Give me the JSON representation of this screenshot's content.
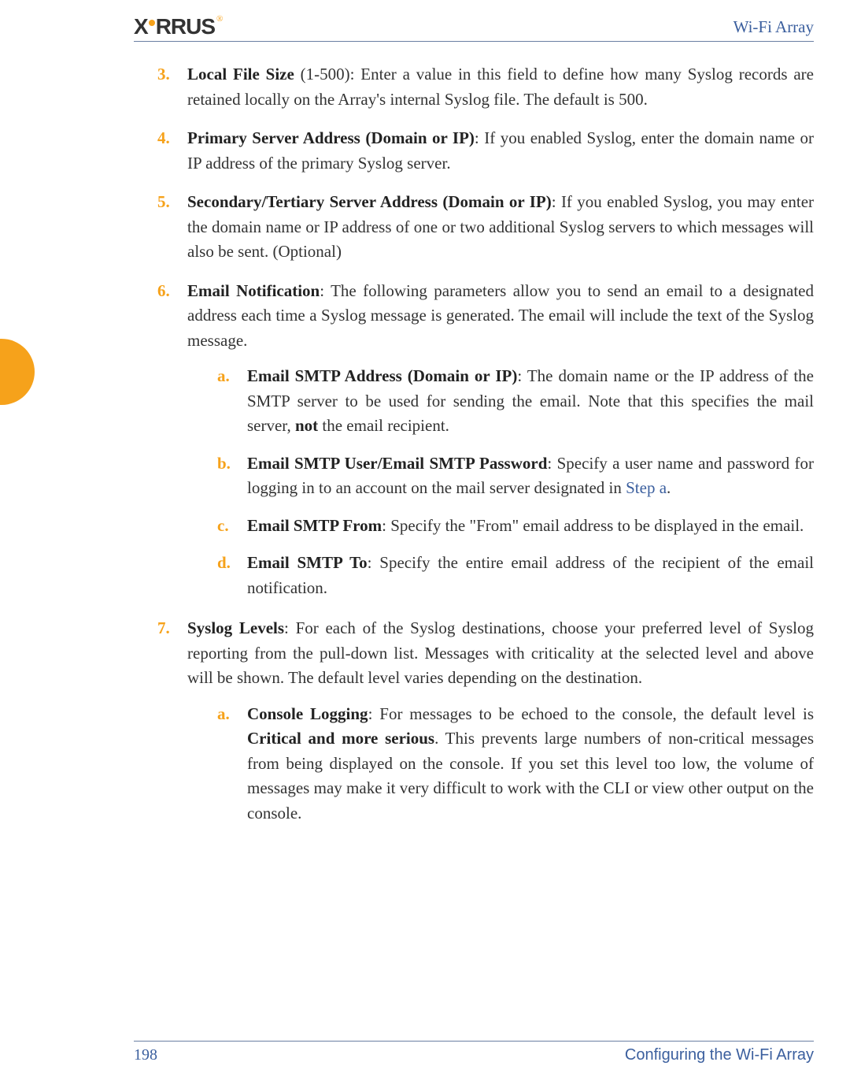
{
  "header": {
    "brand": "XIRRUS",
    "title": "Wi-Fi Array"
  },
  "items": [
    {
      "num": "3.",
      "title": "Local File Size",
      "title_suffix": " (1-500): ",
      "text": "Enter a value in this field to define how many Syslog records are retained locally on the Array's internal Syslog file. The default is 500."
    },
    {
      "num": "4.",
      "title": "Primary Server Address (Domain or IP)",
      "title_suffix": ": ",
      "text": "If you enabled Syslog, enter the domain name or IP address of the primary Syslog server."
    },
    {
      "num": "5.",
      "title": "Secondary/Tertiary Server Address (Domain or IP)",
      "title_suffix": ": ",
      "text": "If you enabled Syslog, you may enter the domain name or IP address of one or two additional Syslog servers to which messages will also be sent. (Optional)"
    },
    {
      "num": "6.",
      "title": "Email Notification",
      "title_suffix": ": ",
      "text": "The following parameters allow you to send an email to a designated address each time a Syslog message is generated. The email will include the text of the Syslog message.",
      "subs": [
        {
          "num": "a.",
          "title": "Email SMTP Address (Domain or IP)",
          "title_suffix": ": ",
          "text_before_bold": "The domain name or the IP address of the SMTP server to be used for sending the email. Note that this specifies the mail server, ",
          "bold_word": "not",
          "text_after_bold": " the email recipient."
        },
        {
          "num": "b.",
          "title": "Email SMTP User/Email SMTP Password",
          "title_suffix": ": ",
          "text_before_link": "Specify a user name and password for logging in to an account on the mail server designated in ",
          "link_text": "Step a",
          "text_after_link": "."
        },
        {
          "num": "c.",
          "title": "Email SMTP From",
          "title_suffix": ": ",
          "text": "Specify the \"From\" email address to be displayed in the email."
        },
        {
          "num": "d.",
          "title": "Email SMTP To",
          "title_suffix": ": ",
          "text": "Specify the entire email address of the recipient of the email notification."
        }
      ]
    },
    {
      "num": "7.",
      "title": "Syslog Levels",
      "title_suffix": ": ",
      "text": "For each of the Syslog destinations, choose your preferred level of Syslog reporting from the pull-down list. Messages with criticality at the selected level and above will be shown. The default level varies depending on the destination.",
      "subs": [
        {
          "num": "a.",
          "title": "Console Logging",
          "title_suffix": ": ",
          "text_before_bold": "For messages to be echoed to the console, the default level is ",
          "bold_word": "Critical and more serious",
          "text_after_bold": ". This prevents large numbers of non-critical messages from being displayed on the console. If you set this level too low, the volume of messages may make it very difficult to work with the CLI or view other output on the console."
        }
      ]
    }
  ],
  "footer": {
    "page": "198",
    "section": "Configuring the Wi-Fi Array"
  }
}
